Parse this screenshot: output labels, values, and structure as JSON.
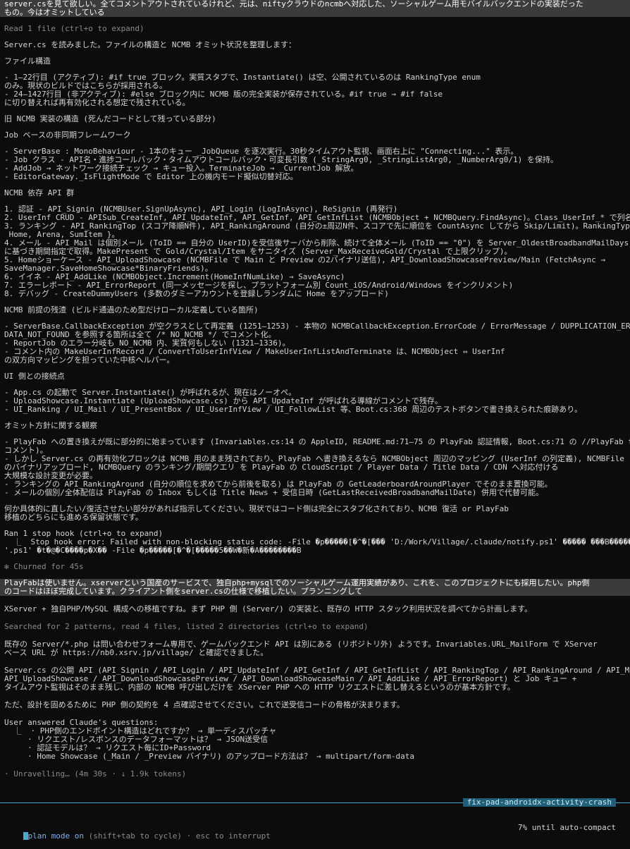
{
  "lines": [
    {
      "t": "server.csを見て欲しい。全てコメントアウトされているけれど、元は、niftyクラウドのncmbへ対応した、ソーシャルゲーム用モバイルバックエンドの実装だった",
      "k": "user"
    },
    {
      "t": "もの。今はオミットしている",
      "k": "user"
    },
    {
      "t": "",
      "k": "gap"
    },
    {
      "t": "Read 1 file (ctrl+o to expand)",
      "k": "muted"
    },
    {
      "t": "",
      "k": "gap"
    },
    {
      "t": "Server.cs を読みました。ファイルの構造と NCMB オミット状況を整理します：",
      "k": "text"
    },
    {
      "t": "",
      "k": "gap"
    },
    {
      "t": "ファイル構造",
      "k": "text"
    },
    {
      "t": "",
      "k": "gap"
    },
    {
      "t": "- 1–22行目 (アクティブ): #if true ブロック。実質スタブで、Instantiate() は空、公開されているのは RankingType enum",
      "k": "text"
    },
    {
      "t": "のみ。現状のビルドではこちらが採用される。",
      "k": "text"
    },
    {
      "t": "- 24–1427行目 (非アクティブ): #else ブロック内に NCMB 版の完全実装が保存されている。#if true → #if false",
      "k": "text"
    },
    {
      "t": "に切り替えれば再有効化される想定で残されている。",
      "k": "text"
    },
    {
      "t": "",
      "k": "gap"
    },
    {
      "t": "旧 NCMB 実装の構造 (死んだコードとして残っている部分)",
      "k": "text"
    },
    {
      "t": "",
      "k": "gap"
    },
    {
      "t": "Job ベースの非同期フレームワーク",
      "k": "text"
    },
    {
      "t": "",
      "k": "gap"
    },
    {
      "t": "- ServerBase : MonoBehaviour - 1本のキュー _JobQueue を逐次実行。30秒タイムアウト監視、画面右上に \"Connecting...\" 表示。",
      "k": "text"
    },
    {
      "t": "- Job クラス - API名・進捗コールバック・タイムアウトコールバック・可変長引数 (_StringArg0, _StringListArg0, _NumberArg0/1) を保持。",
      "k": "text"
    },
    {
      "t": "- AddJob → ネットワーク接続チェック → キュー投入。TerminateJob → _CurrentJob 解放。",
      "k": "text"
    },
    {
      "t": "- EditorGateway._IsFlightMode で Editor 上の機内モード擬似切替対応。",
      "k": "text"
    },
    {
      "t": "",
      "k": "gap"
    },
    {
      "t": "NCMB 依存 API 群",
      "k": "text"
    },
    {
      "t": "",
      "k": "gap"
    },
    {
      "t": "1. 認証 - API_Signin (NCMBUser.SignUpAsync), API_Login (LogInAsync), ReSignin (再発行)",
      "k": "text"
    },
    {
      "t": "2. UserInf CRUD - APISub_CreateInf, API_UpdateInf, API_GetInf, API_GetInfList (NCMBObject + NCMBQuery.FindAsync)。Class_UserInf_* で列名を大量定義。",
      "k": "text"
    },
    {
      "t": "3. ランキング - API_RankingTop (スコア降順N件), API_RankingAround (自分の±周辺N件、スコアで先に順位を CountAsync してから Skip/Limit)。RankingType {",
      "k": "text"
    },
    {
      "t": " Home, Arena, SumItem }。",
      "k": "text"
    },
    {
      "t": "4. メール - API_Mail は個別メール (ToID == 自分の UserID)を受信後サーバから削除、続けて全体メール (ToID == \"0\") を Server_OldestBroadbandMailDays",
      "k": "text"
    },
    {
      "t": "に基づき期間指定で取得。MakePresent で Gold/Crystal/Item をサニタイズ (Server_MaxReceiveGold/Crystal で上限クリップ)。",
      "k": "text"
    },
    {
      "t": "5. Homeショーケース - API_UploadShowcase (NCMBFile で Main と Preview の2バイナリ送信), API_DownloadShowcasePreview/Main (FetchAsync →",
      "k": "text"
    },
    {
      "t": "SaveManager.SaveHomeShowcase*BinaryFriends)。",
      "k": "text"
    },
    {
      "t": "6. イイネ - API_AddLike (NCMBObject.Increment(HomeInfNumLike) → SaveAsync)",
      "k": "text"
    },
    {
      "t": "7. エラーレポート - API_ErrorReport (同一メッセージを探し、プラットフォーム別 Count_iOS/Android/Windows をインクリメント)",
      "k": "text"
    },
    {
      "t": "8. デバッグ - CreateDummyUsers (多数のダミーアカウントを登録しランダムに Home をアップロード)",
      "k": "text"
    },
    {
      "t": "",
      "k": "gap"
    },
    {
      "t": "NCMB 前提の残渣 (ビルド通過のため型だけローカル定義している箇所)",
      "k": "text"
    },
    {
      "t": "",
      "k": "gap"
    },
    {
      "t": "- ServerBase.CallbackException が空クラスとして再定義 (1251–1253) - 本物の NCMBCallbackException.ErrorCode / ErrorMessage / DUPPLICATION_ERROR /",
      "k": "text"
    },
    {
      "t": "DATA_NOT_FOUND を参照する箇所は全て /* NO_NCMB */ でコメント化。",
      "k": "text"
    },
    {
      "t": "- ReportJob のエラー分岐も NO_NCMB 内、実質何もしない (1321–1336)。",
      "k": "text"
    },
    {
      "t": "- コメント内の MakeUserInfRecord / ConvertToUserInfView / MakeUserInfListAndTerminate は、NCMBObject ⇔ UserInf",
      "k": "text"
    },
    {
      "t": "の双方向マッピングを担っていた中核ヘルパー。",
      "k": "text"
    },
    {
      "t": "",
      "k": "gap"
    },
    {
      "t": "UI 側との接続点",
      "k": "text"
    },
    {
      "t": "",
      "k": "gap"
    },
    {
      "t": "- App.cs の起動で Server.Instantiate() が呼ばれるが、現在はノーオペ。",
      "k": "text"
    },
    {
      "t": "- UploadShowcase.Instantiate (UploadShowcase.cs) から API_UpdateInf が呼ばれる導線がコメントで残存。",
      "k": "text"
    },
    {
      "t": "- UI_Ranking / UI_Mail / UI_PresentBox / UI_UserInfView / UI_FollowList 等、Boot.cs:368 周辺のテストボタンで書き換えられた痕跡あり。",
      "k": "text"
    },
    {
      "t": "",
      "k": "gap"
    },
    {
      "t": "オミット方針に関する観察",
      "k": "text"
    },
    {
      "t": "",
      "k": "gap"
    },
    {
      "t": "- PlayFab への置き換えが既に部分的に始まっています (Invariables.cs:14 の AppleID, README.md:71–75 の PlayFab 認証情報, Boot.cs:71 の //PlayFab test",
      "k": "text"
    },
    {
      "t": "コメント)。",
      "k": "text"
    },
    {
      "t": "- しかし Server.cs の再有効化ブロックは NCMB 用のまま残されており、PlayFab へ書き換えるなら NCMBObject 周辺のマッピング (UserInf の列定義), NCMBFile",
      "k": "text"
    },
    {
      "t": "のバイナリアップロード, NCMBQuery のランキング/期間クエリ を PlayFab の CloudScript / Player Data / Title Data / CDN へ対応付ける",
      "k": "text"
    },
    {
      "t": "大規模な設計変更が必要。",
      "k": "text"
    },
    {
      "t": "- ランキングの API_RankingAround (自分の順位を求めてから前後を取る) は PlayFab の GetLeaderboardAroundPlayer でそのまま置換可能。",
      "k": "text"
    },
    {
      "t": "- メールの個別/全体配信は PlayFab の Inbox もしくは Title News + 受信日時 (GetLastReceivedBroadbandMailDate) 併用で代替可能。",
      "k": "text"
    },
    {
      "t": "",
      "k": "gap"
    },
    {
      "t": "何か具体的に直したい/復活させたい部分があれば指示してください。現状ではコード側は完全にスタブ化されており、NCMB 復活 or PlayFab",
      "k": "text"
    },
    {
      "t": "移植のどちらにも進める保留状態です。",
      "k": "text"
    },
    {
      "t": "",
      "k": "gap"
    },
    {
      "t": "Ran 1 stop hook (ctrl+o to expand)",
      "k": "text"
    },
    {
      "t": "  ⎿  Stop hook error: Failed with non-blocking status code: -File �p�����[�^�[��� 'D:/Work/Village/.claude/notify.ps1' ����� ���B������",
      "k": "text"
    },
    {
      "t": "'.ps1' �t�@�C����p�X�� -File �p�����[�^�[�����5��Ŵ�新�Ã��������B",
      "k": "text"
    },
    {
      "t": "",
      "k": "gap"
    },
    {
      "t": "✻ Churned for 45s",
      "k": "muted"
    },
    {
      "t": "",
      "k": "gap"
    },
    {
      "t": "PlayFabは使いません。xserverという国産のサービスで、独自php+mysqlでのソーシャルゲーム運用実績があり、これを、このプロジェクトにも採用したい。php側",
      "k": "user"
    },
    {
      "t": "のコードはほぼ完成しています。クライアント側をserver.csの仕様で移植したい。プランニングして",
      "k": "user"
    },
    {
      "t": "",
      "k": "gap2"
    },
    {
      "t": "XServer + 独自PHP/MySQL 構成への移植ですね。まず PHP 側 (Server/) の実装と、既存の HTTP スタック利用状況を調べてから計画します。",
      "k": "text"
    },
    {
      "t": "",
      "k": "gap2"
    },
    {
      "t": "Searched for 2 patterns, read 4 files, listed 2 directories (ctrl+o to expand)",
      "k": "muted"
    },
    {
      "t": "",
      "k": "gap2"
    },
    {
      "t": "既存の Server/*.php は問い合わせフォーム専用で、ゲームバックエンド API は別にある (リポジトリ外) ようです。Invariables.URL_MailForm で XServer",
      "k": "text"
    },
    {
      "t": "ベース URL が https://nb0.xsrv.jp/village/ と確認できました。",
      "k": "text"
    },
    {
      "t": "",
      "k": "gap2"
    },
    {
      "t": "Server.cs の公開 API (API_Signin / API_Login / API_UpdateInf / API_GetInf / API_GetInfList / API_RankingTop / API_RankingAround / API_Mail /",
      "k": "text"
    },
    {
      "t": "API_UploadShowcase / API_DownloadShowcasePreview / API_DownloadShowcaseMain / API_AddLike / API_ErrorReport) と Job キュー +",
      "k": "text"
    },
    {
      "t": "タイムアウト監視はそのまま残し、内部の NCMB 呼び出しだけを XServer PHP への HTTP リクエストに差し替えるというのが基本方針です。",
      "k": "text"
    },
    {
      "t": "",
      "k": "gap2"
    },
    {
      "t": "ただ、設計を固めるために PHP 側の契約を 4 点確認させてください。これで送受信コードの骨格が決まります。",
      "k": "text"
    },
    {
      "t": "",
      "k": "gap2"
    },
    {
      "t": "User answered Claude's questions:",
      "k": "text"
    },
    {
      "t": "  ⎿  · PHP側のエンドポイント構造はどれですか？ → 単一ディスパッチャ",
      "k": "text"
    },
    {
      "t": "     · リクエスト/レスポンスのデータフォーマットは？ → JSON送受信",
      "k": "text"
    },
    {
      "t": "     · 認証モデルは？ → リクエスト毎にID+Password",
      "k": "text"
    },
    {
      "t": "     · Home Showcase (_Main / _Preview バイナリ) のアップロード方法は？ → multipart/form-data",
      "k": "text"
    },
    {
      "t": "",
      "k": "gap2"
    },
    {
      "t": "· Unravelling… (4m 30s · ↓ 1.9k tokens)",
      "k": "muted"
    }
  ],
  "branch": "fix-pad-androidx-activity-crash",
  "status": {
    "mode": "plan mode on",
    "hint": " (shift+tab to cycle) · esc to interrupt",
    "right": "7% until auto-compact"
  },
  "colors": {
    "accent": "#4da7c9",
    "user_bg": "#3b3b3b",
    "muted": "#8a8a8a"
  }
}
